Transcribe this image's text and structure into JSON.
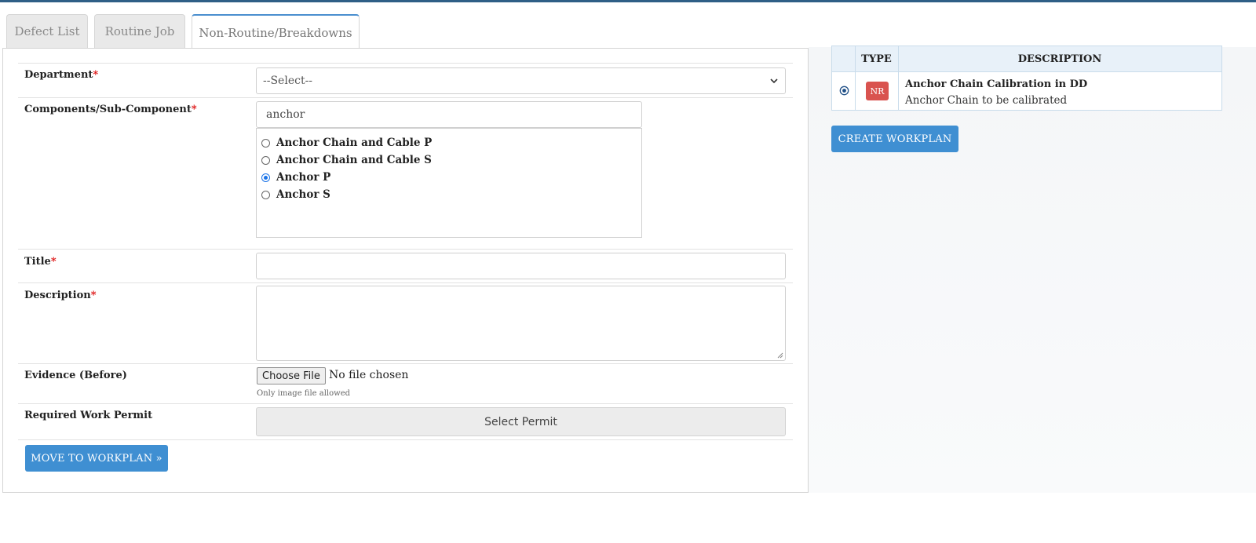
{
  "tabs": [
    {
      "label": "Defect List"
    },
    {
      "label": "Routine Job"
    },
    {
      "label": "Non-Routine/Breakdowns",
      "active": true
    }
  ],
  "form": {
    "department": {
      "label": "Department",
      "required_mark": "*",
      "selected": "--Select--"
    },
    "component": {
      "label": "Components/Sub-Component",
      "required_mark": "*",
      "search_value": "anchor",
      "options": [
        {
          "label": "Anchor Chain and Cable P",
          "checked": false
        },
        {
          "label": "Anchor Chain and Cable S",
          "checked": false
        },
        {
          "label": "Anchor P",
          "checked": true
        },
        {
          "label": "Anchor S",
          "checked": false
        }
      ]
    },
    "title": {
      "label": "Title",
      "required_mark": "*",
      "value": ""
    },
    "description": {
      "label": "Description",
      "required_mark": "*",
      "value": ""
    },
    "evidence": {
      "label": "Evidence (Before)",
      "button_label": "Choose File",
      "status": "No file chosen",
      "hint": "Only image file allowed"
    },
    "permit": {
      "label": "Required Work Permit",
      "button_label": "Select Permit"
    },
    "move_button": "MOVE TO WORKPLAN »"
  },
  "workplan_table": {
    "headers": {
      "type": "TYPE",
      "description": "DESCRIPTION"
    },
    "rows": [
      {
        "badge": "NR",
        "title": "Anchor Chain Calibration in DD",
        "subtitle": "Anchor Chain to be calibrated"
      }
    ]
  },
  "create_button": "CREATE WORKPLAN",
  "colors": {
    "accent": "#3f8fd2",
    "badge": "#d9534f",
    "required": "#dd1111",
    "topbar": "#2f5f86"
  }
}
